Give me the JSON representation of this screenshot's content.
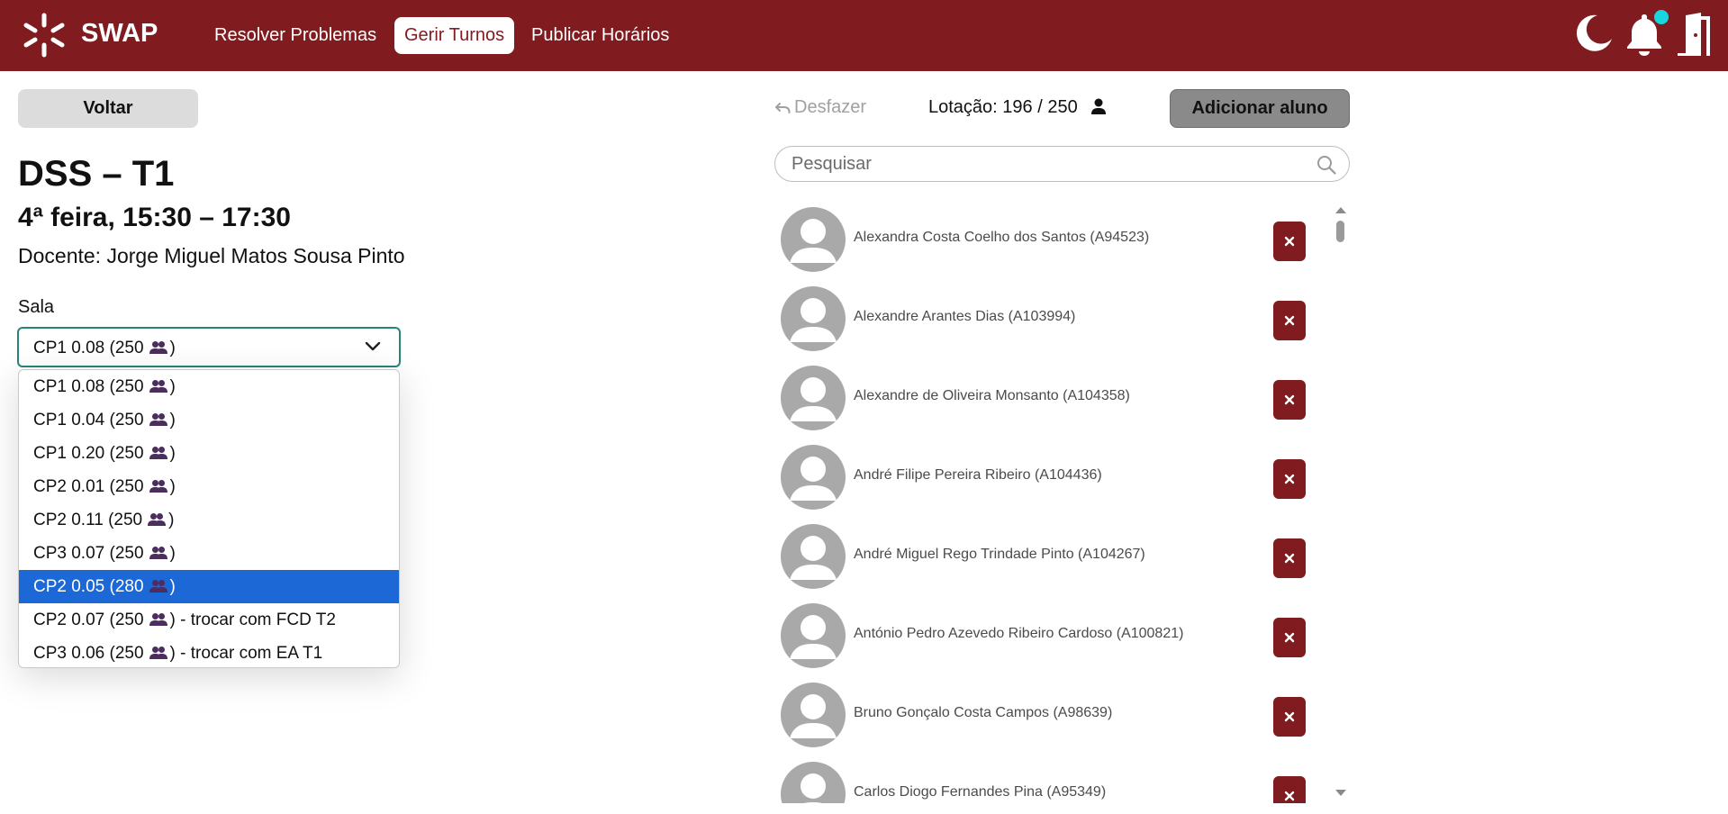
{
  "header": {
    "brand": "SWAP",
    "nav": [
      "Resolver Problemas",
      "Gerir Turnos",
      "Publicar Horários"
    ],
    "active_nav": "Gerir Turnos",
    "icons": [
      "moon-icon",
      "bell-icon",
      "logout-door-icon"
    ],
    "notification_dot_color": "#17d6e0"
  },
  "left": {
    "back_label": "Voltar",
    "title": "DSS – T1",
    "schedule": "4ª feira, 15:30 – 17:30",
    "teacher": "Docente: Jorge Miguel Matos Sousa Pinto",
    "room_label": "Sala",
    "room_selected": {
      "prefix": "CP1 0.08 (250",
      "suffix": ")"
    },
    "room_options": [
      {
        "prefix": "CP1 0.08 (250",
        "suffix": ")"
      },
      {
        "prefix": "CP1 0.04 (250",
        "suffix": ")"
      },
      {
        "prefix": "CP1 0.20 (250",
        "suffix": ")"
      },
      {
        "prefix": "CP2 0.01 (250",
        "suffix": ")"
      },
      {
        "prefix": "CP2 0.11 (250",
        "suffix": ")"
      },
      {
        "prefix": "CP3 0.07 (250",
        "suffix": ")"
      },
      {
        "prefix": "CP2 0.05 (280",
        "suffix": ")",
        "highlighted": true
      },
      {
        "prefix": "CP2 0.07 (250",
        "suffix": ") - trocar com FCD T2"
      },
      {
        "prefix": "CP3 0.06 (250",
        "suffix": ") - trocar com EA T1"
      }
    ]
  },
  "right": {
    "undo_label": "Desfazer",
    "capacity_text": "Lotação: 196 / 250",
    "add_label": "Adicionar aluno",
    "search_placeholder": "Pesquisar",
    "students": [
      "Alexandra Costa Coelho dos Santos (A94523)",
      "Alexandre Arantes Dias (A103994)",
      "Alexandre de Oliveira Monsanto (A104358)",
      "André Filipe Pereira Ribeiro (A104436)",
      "André Miguel Rego Trindade Pinto (A104267)",
      "António Pedro Azevedo Ribeiro Cardoso (A100821)",
      "Bruno Gonçalo Costa Campos (A98639)",
      "Carlos Diogo Fernandes Pina (A95349)"
    ]
  },
  "colors": {
    "brand": "#801b1f",
    "select_border": "#27847a",
    "highlight": "#1c68d6"
  }
}
